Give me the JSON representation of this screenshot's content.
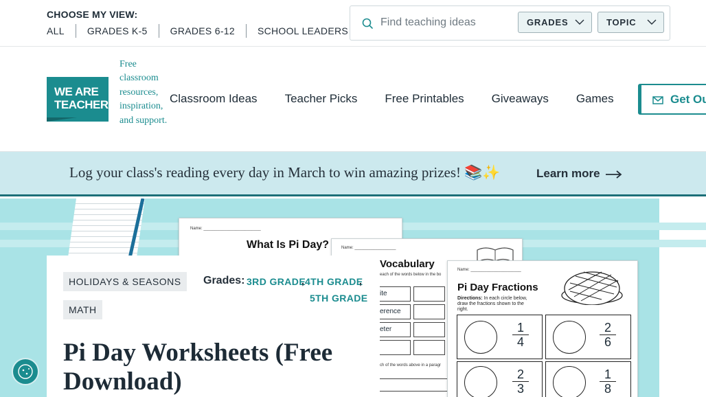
{
  "topbar": {
    "view_title": "CHOOSE MY VIEW:",
    "view_links": [
      "ALL",
      "GRADES K-5",
      "GRADES 6-12",
      "SCHOOL LEADERS"
    ],
    "search": {
      "placeholder": "Find teaching ideas",
      "value": ""
    },
    "grades_select": "GRADES",
    "topic_select": "TOPIC"
  },
  "header": {
    "logo_line1": "WE ARE",
    "logo_line2": "TEACHERS",
    "tagline": "Free classroom resources, inspiration, and support.",
    "nav": [
      "Classroom Ideas",
      "Teacher Picks",
      "Free Printables",
      "Giveaways",
      "Games"
    ],
    "cta": "Get Our"
  },
  "banner": {
    "text": "Log your class's reading every day in March to win amazing prizes! 📚✨",
    "link": "Learn more"
  },
  "hero": {
    "worksheet1_name": "Name: _________________________",
    "worksheet1_title": "What Is Pi Day?",
    "worksheet2_name": "Name: __________________",
    "worksheet2_title": "Vocabulary",
    "worksheet2_instr": "each of the words below in the bo",
    "worksheet2_words": [
      "ite",
      "erence",
      "eter"
    ],
    "worksheet2_footer": "ch of the words above in a paragr",
    "worksheet3_name": "Name: ______________________",
    "worksheet3_title": "Pi Day Fractions",
    "worksheet3_directions_label": "Directions:",
    "worksheet3_directions": "In each circle below, draw the fractions shown to the right.",
    "fractions": [
      {
        "num": "1",
        "den": "4"
      },
      {
        "num": "2",
        "den": "6"
      },
      {
        "num": "2",
        "den": "3"
      },
      {
        "num": "1",
        "den": "8"
      }
    ]
  },
  "card": {
    "tags": [
      "HOLIDAYS & SEASONS",
      "MATH"
    ],
    "grades_label": "Grades:",
    "grades": [
      "3RD GRADE",
      "4TH GRADE",
      "5TH GRADE"
    ],
    "title": "Pi Day Worksheets (Free Download)"
  },
  "colors": {
    "brand": "#1b8c8f",
    "banner_bg": "#cce9ee",
    "hero_bg": "#a9e3e6"
  }
}
